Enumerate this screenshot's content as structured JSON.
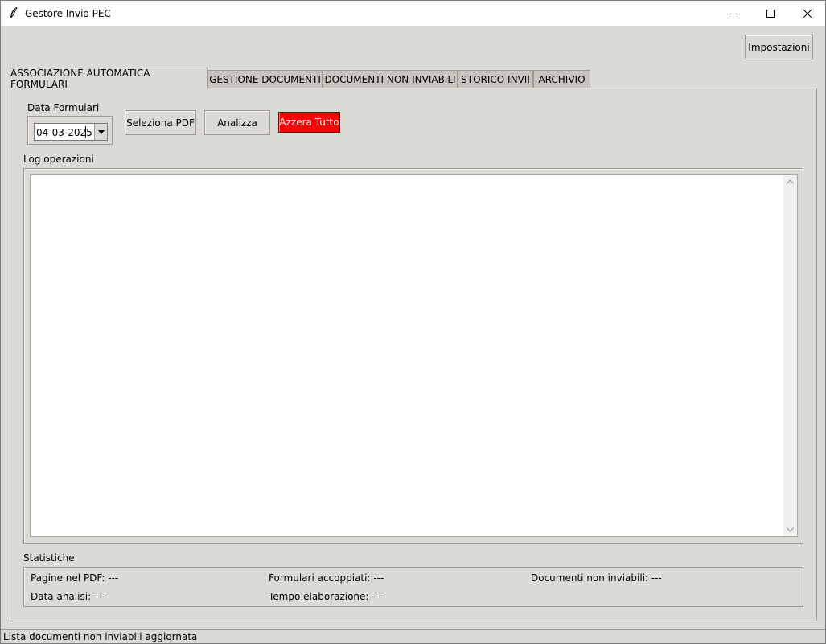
{
  "window": {
    "title": "Gestore Invio PEC"
  },
  "header": {
    "settings_label": "Impostazioni"
  },
  "tabs": [
    {
      "label": "ASSOCIAZIONE AUTOMATICA FORMULARI",
      "active": true
    },
    {
      "label": "GESTIONE DOCUMENTI",
      "active": false
    },
    {
      "label": "DOCUMENTI NON INVIABILI",
      "active": false
    },
    {
      "label": "STORICO INVII",
      "active": false
    },
    {
      "label": "ARCHIVIO",
      "active": false
    }
  ],
  "controls": {
    "date_label": "Data Formulari",
    "date_value": "04-03-2025",
    "select_pdf_label": "Seleziona PDF",
    "analyze_label": "Analizza",
    "reset_label": "Azzera Tutto"
  },
  "log": {
    "label": "Log operazioni",
    "content": ""
  },
  "stats": {
    "label": "Statistiche",
    "pages": "Pagine nel PDF: ---",
    "matched": "Formulari accoppiati: ---",
    "not_sendable": "Documenti non inviabili: ---",
    "date": "Data analisi: ---",
    "time": "Tempo elaborazione: ---"
  },
  "status": {
    "text": "Lista documenti non inviabili aggiornata"
  },
  "colors": {
    "background": "#dcdad5",
    "reset_button": "#ff0000"
  },
  "icons": [
    "feather-icon",
    "minimize-icon",
    "maximize-icon",
    "close-icon",
    "chevron-down-icon",
    "scroll-up-icon",
    "scroll-down-icon"
  ]
}
